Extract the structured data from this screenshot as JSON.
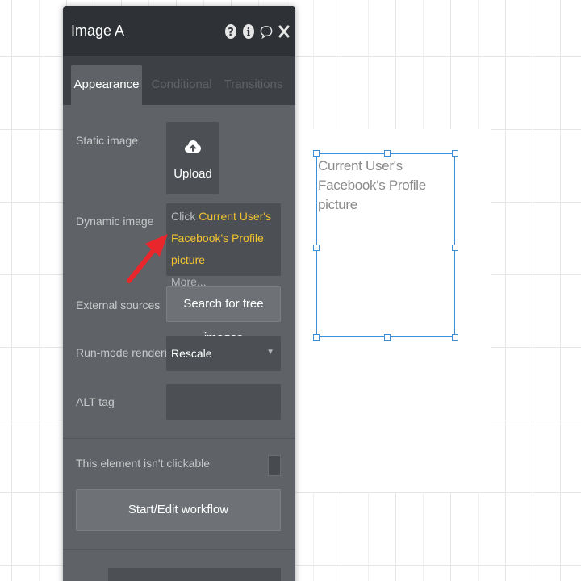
{
  "panel": {
    "title": "Image A",
    "header_icons": [
      "help-icon",
      "info-icon",
      "comment-icon",
      "close-icon"
    ],
    "tabs": [
      {
        "label": "Appearance",
        "active": true
      },
      {
        "label": "Conditional",
        "active": false
      },
      {
        "label": "Transitions",
        "active": false
      }
    ],
    "static_image": {
      "label": "Static image",
      "upload_label": "Upload"
    },
    "dynamic_image": {
      "label": "Dynamic image",
      "click_text": "Click",
      "expression_line1": "Current User's",
      "expression_line2": "Facebook's Profile picture",
      "more_text": "More..."
    },
    "external_sources": {
      "label": "External sources",
      "button_label": "Search for free images"
    },
    "run_mode_rendering": {
      "label": "Run-mode rendering",
      "value": "Rescale"
    },
    "alt_tag": {
      "label": "ALT tag",
      "value": ""
    },
    "clickable": {
      "label": "This element isn't clickable",
      "checked": false
    },
    "workflow_button_label": "Start/Edit workflow"
  },
  "canvas": {
    "image_element_text": "Current User's Facebook's Profile picture"
  },
  "colors": {
    "accent_expression": "#f2c230",
    "selection_border": "#3a8fd8",
    "annotation_arrow": "#e8262b",
    "panel_header": "#2e3135",
    "panel_body": "#5f6266"
  }
}
